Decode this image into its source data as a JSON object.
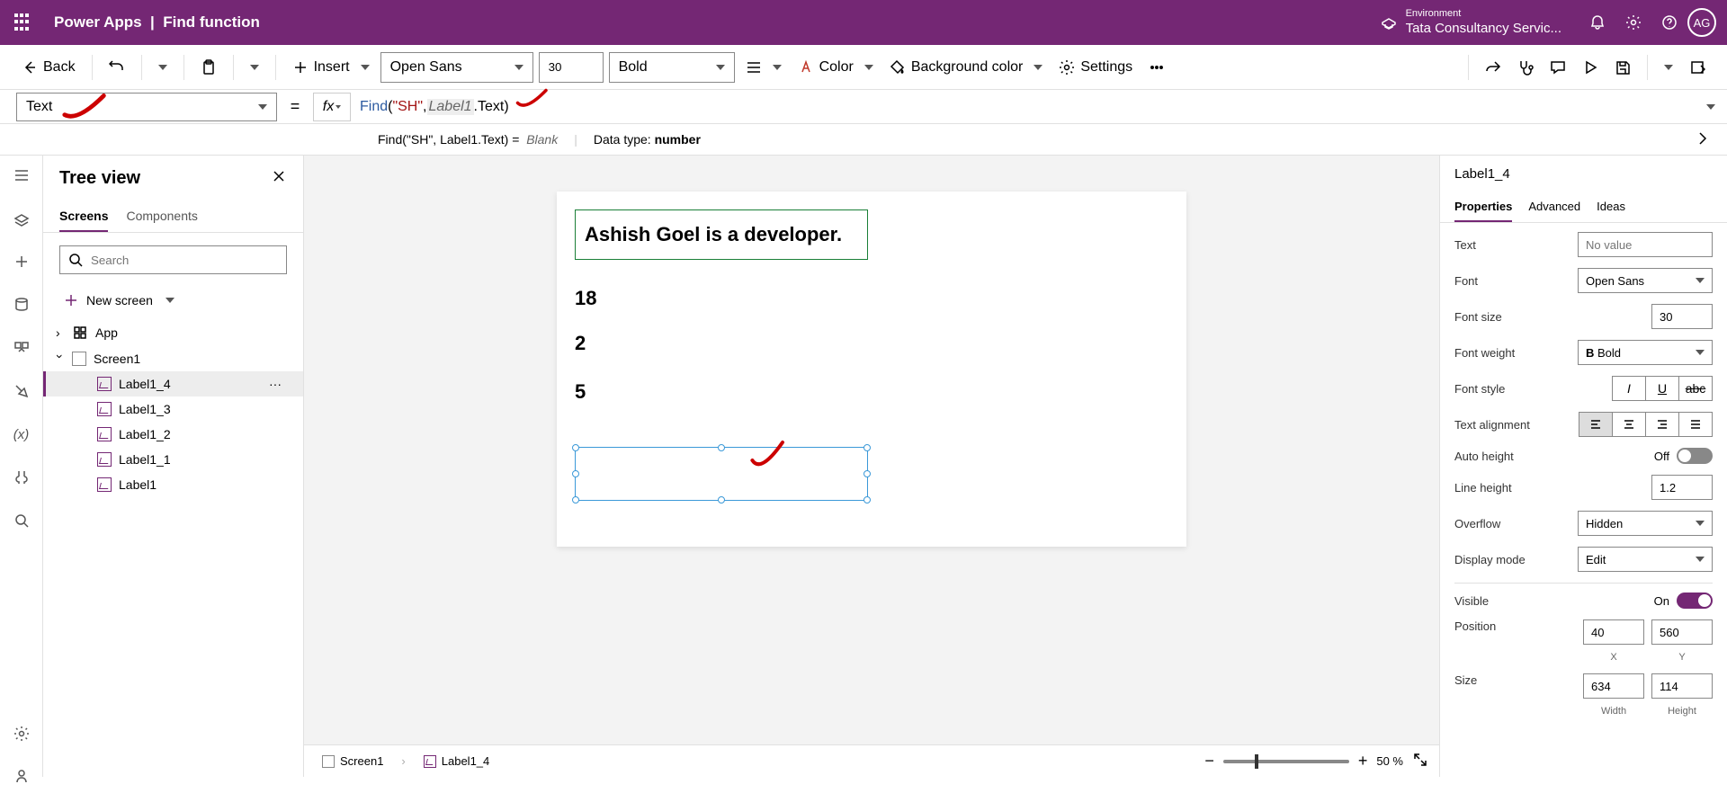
{
  "header": {
    "app": "Power Apps",
    "page": "Find function",
    "env_label": "Environment",
    "env_name": "Tata Consultancy Servic...",
    "avatar": "AG"
  },
  "toolbar": {
    "back": "Back",
    "insert": "Insert",
    "font": "Open Sans",
    "font_size": "30",
    "weight": "Bold",
    "color": "Color",
    "bgcolor": "Background color",
    "settings": "Settings"
  },
  "formula": {
    "property": "Text",
    "fx": "fx",
    "fn": "Find",
    "arg_str": "\"SH\"",
    "arg_ref": "Label1",
    "arg_suffix": ".Text)",
    "result_text": "Find(\"SH\", Label1.Text)  =",
    "result_value": "Blank",
    "datatype_label": "Data type:",
    "datatype": "number"
  },
  "tree": {
    "title": "Tree view",
    "tabs": {
      "screens": "Screens",
      "components": "Components"
    },
    "search_placeholder": "Search",
    "new_screen": "New screen",
    "app": "App",
    "screen": "Screen1",
    "items": [
      "Label1_4",
      "Label1_3",
      "Label1_2",
      "Label1_1",
      "Label1"
    ]
  },
  "canvas": {
    "label_main": "Ashish Goel is a developer.",
    "label1": "18",
    "label2": "2",
    "label3": "5",
    "breadcrumb_screen": "Screen1",
    "breadcrumb_control": "Label1_4",
    "zoom": "50  %"
  },
  "props": {
    "control": "Label1_4",
    "tabs": {
      "properties": "Properties",
      "advanced": "Advanced",
      "ideas": "Ideas"
    },
    "rows": {
      "text": {
        "label": "Text",
        "value": "No value"
      },
      "font": {
        "label": "Font",
        "value": "Open Sans"
      },
      "font_size": {
        "label": "Font size",
        "value": "30"
      },
      "font_weight": {
        "label": "Font weight",
        "value": "Bold"
      },
      "font_style": {
        "label": "Font style"
      },
      "align": {
        "label": "Text alignment"
      },
      "auto_height": {
        "label": "Auto height",
        "value": "Off"
      },
      "line_height": {
        "label": "Line height",
        "value": "1.2"
      },
      "overflow": {
        "label": "Overflow",
        "value": "Hidden"
      },
      "display_mode": {
        "label": "Display mode",
        "value": "Edit"
      },
      "visible": {
        "label": "Visible",
        "value": "On"
      },
      "position": {
        "label": "Position",
        "x": "40",
        "y": "560",
        "xl": "X",
        "yl": "Y"
      },
      "size": {
        "label": "Size",
        "w": "634",
        "h": "114",
        "wl": "Width",
        "hl": "Height"
      }
    }
  }
}
